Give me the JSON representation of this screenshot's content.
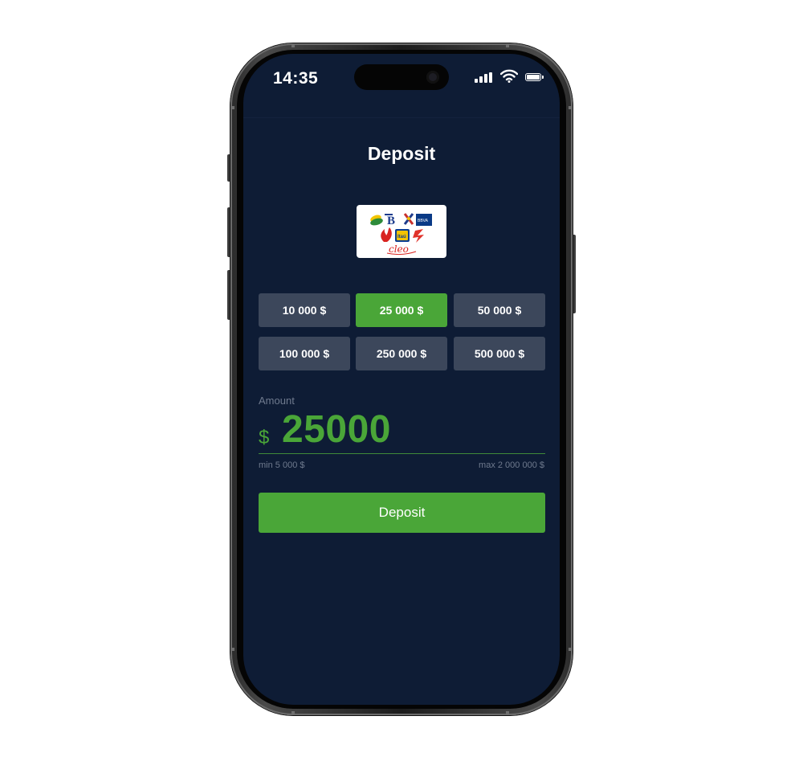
{
  "status_bar": {
    "time": "14:35",
    "icons": [
      "cellular-signal-icon",
      "wifi-icon",
      "battery-icon"
    ]
  },
  "page": {
    "title": "Deposit"
  },
  "payment_method": {
    "logo_text": "cleo",
    "icon": "bank-logos-icon"
  },
  "amount_options": [
    {
      "label": "10 000 $",
      "selected": false
    },
    {
      "label": "25 000 $",
      "selected": true
    },
    {
      "label": "50 000 $",
      "selected": false
    },
    {
      "label": "100 000 $",
      "selected": false
    },
    {
      "label": "250 000 $",
      "selected": false
    },
    {
      "label": "500 000 $",
      "selected": false
    }
  ],
  "amount": {
    "label": "Amount",
    "currency_symbol": "$",
    "value": "25000",
    "min_text": "min 5 000 $",
    "max_text": "max 2 000 000 $"
  },
  "deposit_button": {
    "label": "Deposit"
  },
  "colors": {
    "background": "#0e1c35",
    "accent": "#4aa638",
    "chip": "#3c475b",
    "muted_text": "#6f7a8e"
  }
}
